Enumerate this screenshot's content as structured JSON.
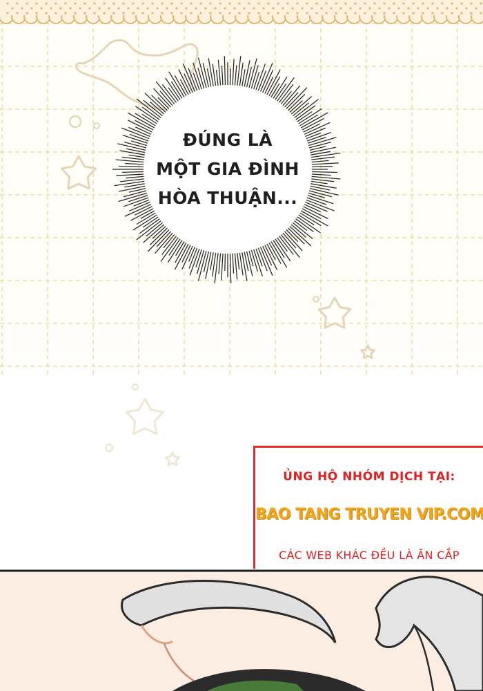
{
  "bubble": {
    "lines": [
      "ĐÚNG LÀ",
      "MỘT GIA ĐÌNH",
      "HÒA THUẬN..."
    ]
  },
  "credit": {
    "support": "ỦNG HỘ NHÓM DỊCH TẠI:",
    "site": "BAO TANG TRUYEN VIP.COM",
    "warning": "CÁC WEB KHÁC ĐỀU LÀ ĂN CẮP"
  },
  "colors": {
    "grid": "#f0dca6",
    "lace": "#dcb878",
    "star": "#e8d9bd",
    "burst": "#2a2a2a",
    "credit_red": "#e02020",
    "credit_orange": "#f0a51a",
    "hair": "#e0e0e0",
    "skin": "#fbede2"
  },
  "icons": [
    "lace-border",
    "star-icon",
    "burst-bubble"
  ]
}
